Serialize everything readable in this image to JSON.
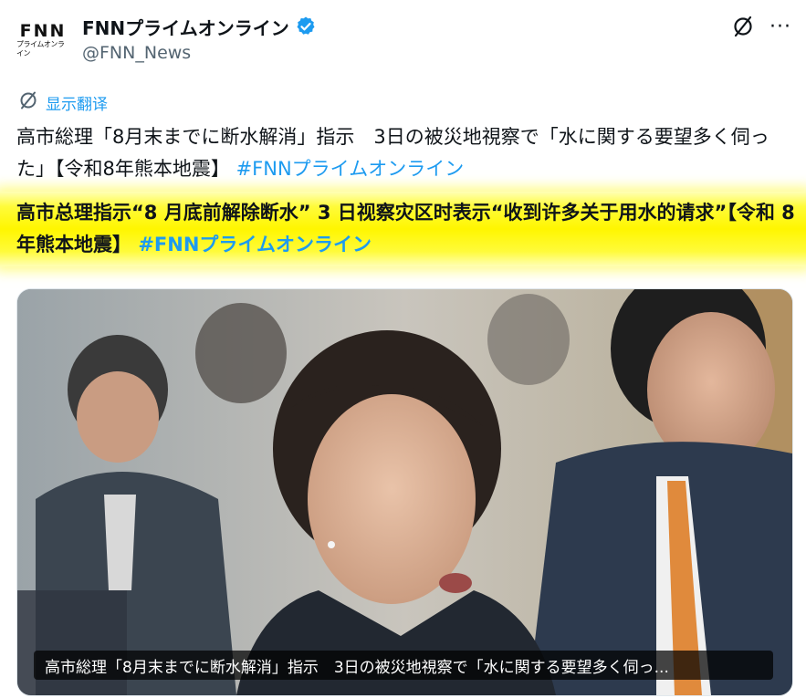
{
  "account": {
    "display_name": "FNNプライムオンライン",
    "handle": "@FNN_News",
    "avatar_logo": "FNN",
    "avatar_sub": "プライムオンライン",
    "verified_icon": "verified-badge-icon",
    "brand_color": "#1d9bf0"
  },
  "actions": {
    "grok_icon": "grok-icon",
    "more_icon": "more-icon",
    "more_glyph": "···"
  },
  "translate": {
    "label": "显示翻译",
    "icon": "translate-icon"
  },
  "tweet": {
    "text": "高市総理「8月末までに断水解消」指示　3日の被災地視察で「水に関する要望多く伺った」【令和8年熊本地震】",
    "hashtag": "#FNNプライムオンライン"
  },
  "translation": {
    "text": "高市总理指示“8 月底前解除断水” 3 日视察灾区时表示“收到许多关于用水的请求”【令和 8 年熊本地震】",
    "hashtag": "#FNNプライムオンライン",
    "highlight_color": "#fff600"
  },
  "media": {
    "caption": "高市総理「8月末までに断水解消」指示　3日の被災地視察で「水に関する要望多く伺っ..."
  }
}
